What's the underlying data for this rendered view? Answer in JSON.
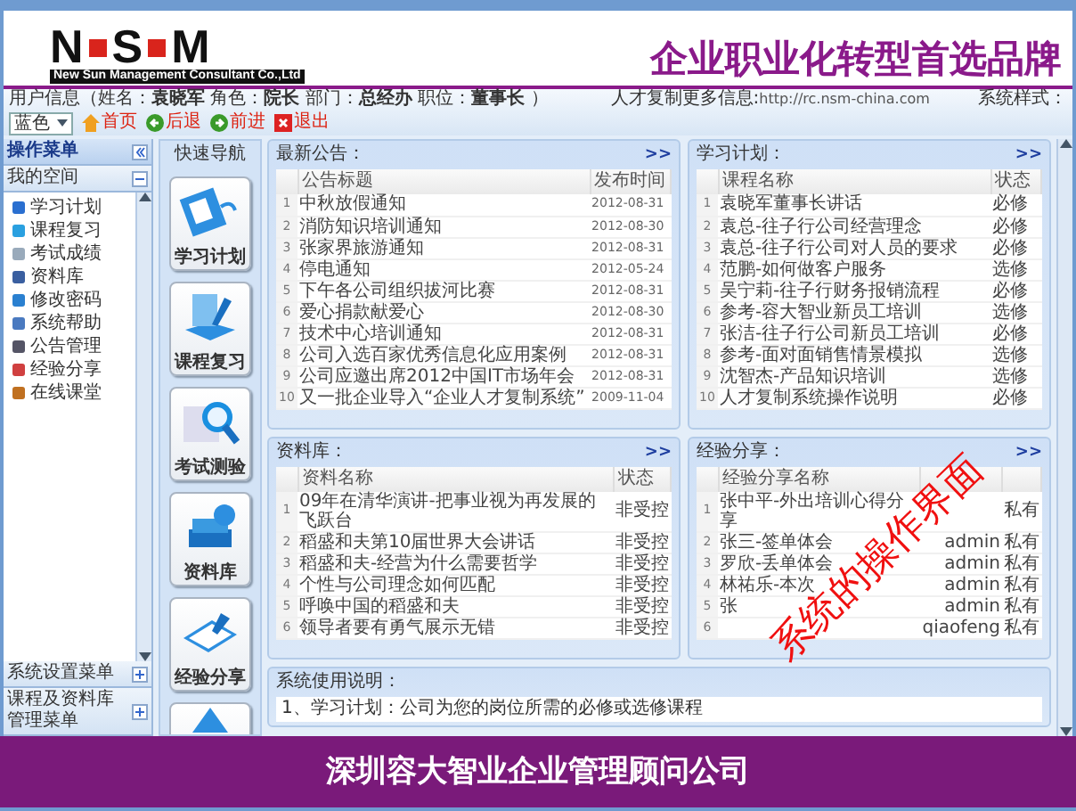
{
  "header": {
    "logo_letters": [
      "N",
      "S",
      "M"
    ],
    "logo_subtitle": "New Sun Management Consultant Co.,Ltd",
    "slogan": "企业职业化转型首选品牌"
  },
  "info_bar": {
    "prefix": "用户信息（",
    "fields": [
      {
        "label": "姓名：",
        "value": "袁晓军"
      },
      {
        "label": "角色：",
        "value": "院长"
      },
      {
        "label": "部门：",
        "value": "总经办"
      },
      {
        "label": "职位：",
        "value": "董事长"
      }
    ],
    "suffix": "）",
    "more_label": "人才复制更多信息:",
    "more_url": "http://rc.nsm-china.com",
    "style_label": "系统样式：",
    "style_value": "蓝色",
    "nav_links": [
      {
        "label": "首页",
        "kind": "home"
      },
      {
        "label": "后退",
        "kind": "back"
      },
      {
        "label": "前进",
        "kind": "forward"
      },
      {
        "label": "退出",
        "kind": "exit"
      }
    ]
  },
  "sidebar": {
    "title": "操作菜单",
    "sections": [
      {
        "label": "我的空间",
        "expanded": true,
        "items": [
          {
            "label": "学习计划",
            "kind": "plan"
          },
          {
            "label": "课程复习",
            "kind": "review"
          },
          {
            "label": "考试成绩",
            "kind": "score"
          },
          {
            "label": "资料库",
            "kind": "library"
          },
          {
            "label": "修改密码",
            "kind": "password"
          },
          {
            "label": "系统帮助",
            "kind": "help"
          },
          {
            "label": "公告管理",
            "kind": "notice"
          },
          {
            "label": "经验分享",
            "kind": "share"
          },
          {
            "label": "在线课堂",
            "kind": "class"
          }
        ]
      },
      {
        "label": "系统设置菜单",
        "expanded": false
      },
      {
        "label": "课程及资料库管理菜单",
        "expanded": false
      }
    ]
  },
  "quick_nav": {
    "title": "快速导航",
    "items": [
      {
        "label": "学习计划",
        "kind": "plan"
      },
      {
        "label": "课程复习",
        "kind": "review"
      },
      {
        "label": "考试测验",
        "kind": "exam"
      },
      {
        "label": "资料库",
        "kind": "library"
      },
      {
        "label": "经验分享",
        "kind": "share"
      },
      {
        "kind": "more"
      }
    ]
  },
  "panels": [
    {
      "title": "最新公告：",
      "more_link": ">>",
      "columns": [
        "",
        "公告标题",
        "发布时间"
      ],
      "rows": [
        [
          "1",
          "中秋放假通知",
          "2012-08-31"
        ],
        [
          "2",
          "消防知识培训通知",
          "2012-08-30"
        ],
        [
          "3",
          "张家界旅游通知",
          "2012-08-31"
        ],
        [
          "4",
          "停电通知",
          "2012-05-24"
        ],
        [
          "5",
          "下午各公司组织拔河比赛",
          "2012-08-31"
        ],
        [
          "6",
          "爱心捐款献爱心",
          "2012-08-30"
        ],
        [
          "7",
          "技术中心培训通知",
          "2012-08-31"
        ],
        [
          "8",
          "公司入选百家优秀信息化应用案例",
          "2012-08-31"
        ],
        [
          "9",
          "公司应邀出席2012中国IT市场年会",
          "2012-08-31"
        ],
        [
          "10",
          "又一批企业导入“企业人才复制系统”",
          "2009-11-04"
        ]
      ]
    },
    {
      "title": "学习计划：",
      "more_link": ">>",
      "columns": [
        "",
        "课程名称",
        "状态"
      ],
      "rows": [
        [
          "1",
          "袁晓军董事长讲话",
          "必修"
        ],
        [
          "2",
          "袁总-往子行公司经营理念",
          "必修"
        ],
        [
          "3",
          "袁总-往子行公司对人员的要求",
          "必修"
        ],
        [
          "4",
          "范鹏-如何做客户服务",
          "选修"
        ],
        [
          "5",
          "吴宁莉-往子行财务报销流程",
          "必修"
        ],
        [
          "6",
          "参考-容大智业新员工培训",
          "选修"
        ],
        [
          "7",
          "张洁-往子行公司新员工培训",
          "必修"
        ],
        [
          "8",
          "参考-面对面销售情景模拟",
          "选修"
        ],
        [
          "9",
          "沈智杰-产品知识培训",
          "选修"
        ],
        [
          "10",
          "人才复制系统操作说明",
          "必修"
        ]
      ]
    },
    {
      "title": "资料库：",
      "more_link": ">>",
      "columns": [
        "",
        "资料名称",
        "状态"
      ],
      "rows": [
        [
          "1",
          "09年在清华演讲-把事业视为再发展的飞跃台",
          "非受控"
        ],
        [
          "2",
          "稻盛和夫第10届世界大会讲话",
          "非受控"
        ],
        [
          "3",
          "稻盛和夫-经营为什么需要哲学",
          "非受控"
        ],
        [
          "4",
          "个性与公司理念如何匹配",
          "非受控"
        ],
        [
          "5",
          "呼唤中国的稻盛和夫",
          "非受控"
        ],
        [
          "6",
          "领导者要有勇气展示无错",
          "非受控"
        ]
      ]
    },
    {
      "title": "经验分享：",
      "more_link": ">>",
      "columns": [
        "",
        "经验分享名称",
        "",
        ""
      ],
      "rows": [
        [
          "1",
          "张中平-外出培训心得分享",
          "",
          "私有"
        ],
        [
          "2",
          "张三-签单体会",
          "admin",
          "私有"
        ],
        [
          "3",
          "罗欣-丢单体会",
          "admin",
          "私有"
        ],
        [
          "4",
          "林祐乐-本次",
          "admin",
          "私有"
        ],
        [
          "5",
          "张",
          "admin",
          "私有"
        ],
        [
          "6",
          "",
          "qiaofeng",
          "私有"
        ]
      ]
    }
  ],
  "usage": {
    "title": "系统使用说明：",
    "lines": [
      "1、学习计划：公司为您的岗位所需的必修或选修课程"
    ]
  },
  "footer": {
    "text": "深圳容大智业企业管理顾问公司"
  },
  "overlay_annotation": "系统的操作界面"
}
